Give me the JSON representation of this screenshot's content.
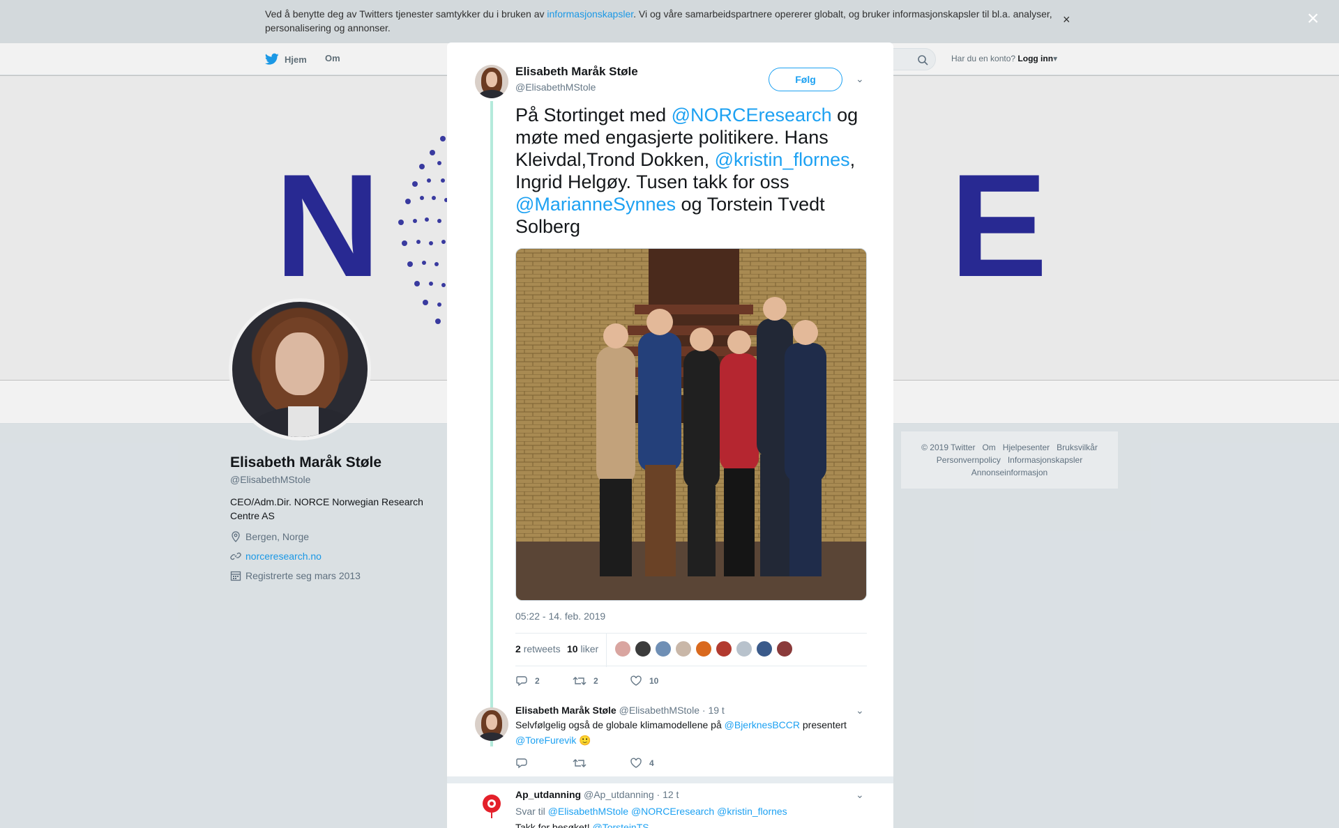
{
  "cookie_bar": {
    "text_before": "Ved å benytte deg av Twitters tjenester samtykker du i bruken av ",
    "link": "informasjonskapsler",
    "text_after": ". Vi og våre samarbeidspartnere opererer globalt, og bruker informasjonskapsler til bl.a. analyser, personalisering og annonser.",
    "close": "×"
  },
  "nav": {
    "home": "Hjem",
    "about": "Om",
    "account_prompt": "Har du en konto?",
    "login": "Logg inn"
  },
  "banner": {
    "letter_left": "N",
    "letter_right": "E"
  },
  "profile": {
    "name": "Elisabeth Maråk Støle",
    "handle": "@ElisabethMStole",
    "bio": "CEO/Adm.Dir. NORCE Norwegian Research Centre AS",
    "location": "Bergen, Norge",
    "website": "norceresearch.no",
    "joined": "Registrerte seg mars 2013"
  },
  "footer": {
    "links": [
      "© 2019 Twitter",
      "Om",
      "Hjelpesenter",
      "Bruksvilkår",
      "Personvernpolicy",
      "Informasjonskapsler",
      "Annonseinformasjon"
    ]
  },
  "overlay_close": "×",
  "tweet": {
    "name": "Elisabeth Maråk Støle",
    "handle": "@ElisabethMStole",
    "follow": "Følg",
    "text_parts": [
      {
        "t": "På Stortinget med ",
        "m": false
      },
      {
        "t": "@NORCEresearch",
        "m": true
      },
      {
        "t": " og møte med engasjerte politikere. Hans Kleivdal,Trond Dokken, ",
        "m": false
      },
      {
        "t": "@kristin_flornes",
        "m": true
      },
      {
        "t": ", Ingrid Helgøy. Tusen takk for oss ",
        "m": false
      },
      {
        "t": "@MarianneSynnes",
        "m": true
      },
      {
        "t": "  og Torstein Tvedt Solberg",
        "m": false
      }
    ],
    "timestamp": "05:22 - 14. feb. 2019",
    "retweets_count": "2",
    "retweets_label": "retweets",
    "likes_count": "10",
    "likes_label": "liker",
    "actions": {
      "reply": "2",
      "retweet": "2",
      "like": "10"
    },
    "liker_colors": [
      "#d9a5a0",
      "#3b3b3b",
      "#6f8fb5",
      "#c9b7a8",
      "#d9691e",
      "#b23a2f",
      "#b8c2cc",
      "#3a5a8a",
      "#8a3a3a"
    ]
  },
  "replies": [
    {
      "name": "Elisabeth Maråk Støle",
      "handle": "@ElisabethMStole",
      "time": "· 19 t",
      "text_parts": [
        {
          "t": "Selvfølgelig også de globale klimamodellene på ",
          "m": false
        },
        {
          "t": "@BjerknesBCCR",
          "m": true
        },
        {
          "t": " presentert ",
          "m": false
        },
        {
          "t": "@ToreFurevik",
          "m": true
        },
        {
          "t": " 🙂",
          "m": false
        }
      ],
      "actions": {
        "reply": "",
        "retweet": "",
        "like": "4"
      }
    },
    {
      "name": "Ap_utdanning",
      "handle": "@Ap_utdanning",
      "time": "· 12 t",
      "reply_to_label": "Svar til",
      "reply_to": [
        "@ElisabethMStole",
        "@NORCEresearch",
        "@kristin_flornes"
      ],
      "text_parts": [
        {
          "t": "Takk for besøket! ",
          "m": false
        },
        {
          "t": "@TorsteinTS",
          "m": true
        }
      ]
    }
  ],
  "colors": {
    "accent": "#1da1f2",
    "norce_blue": "#2b2c9a",
    "thread_line": "#b4eadb"
  }
}
